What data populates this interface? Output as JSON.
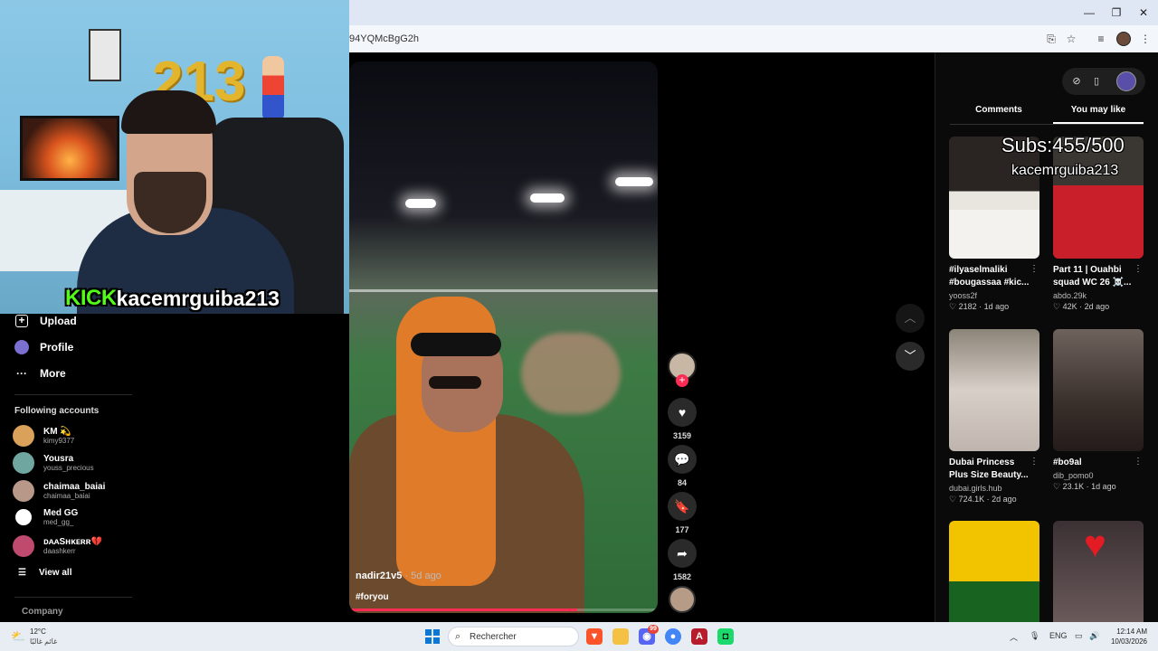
{
  "browser": {
    "url": "94YQMcBgG2h",
    "window_controls": [
      "minimize",
      "maximize",
      "close"
    ]
  },
  "stream": {
    "platform_label": "KICK",
    "channel_name": "kacemrguiba213",
    "balloons_text": "213"
  },
  "sidebar": {
    "nav": [
      {
        "label": "Upload",
        "icon": "upload-icon"
      },
      {
        "label": "Profile",
        "icon": "profile-icon"
      },
      {
        "label": "More",
        "icon": "more-icon"
      }
    ],
    "following_title": "Following accounts",
    "accounts": [
      {
        "name": "KM 💫",
        "handle": "kimy9377",
        "color": "#d9a15a"
      },
      {
        "name": "Yousra",
        "handle": "youss_precious",
        "color": "#6fa6a0"
      },
      {
        "name": "chaimaa_baiai",
        "handle": "chaimaa_baiai",
        "color": "#b89888"
      },
      {
        "name": "Med GG",
        "handle": "med_gg_",
        "color": "#ffffff"
      },
      {
        "name": "ᴅᴀᴀSʜᴋᴇʀʀ💔",
        "handle": "daashkerr",
        "color": "#c04a6e"
      }
    ],
    "view_all": "View all",
    "company": "Company"
  },
  "video": {
    "author": "nadir21v5",
    "age": "· 5d ago",
    "tag": "#foryou",
    "progress_fraction": 0.74
  },
  "actions": {
    "likes": "3159",
    "comments": "84",
    "saves": "177",
    "shares": "1582"
  },
  "right_panel": {
    "tabs": [
      "Comments",
      "You may like"
    ],
    "active_tab": "You may like",
    "overlay_subs": "Subs:455/500",
    "overlay_name": "kacemrguiba213",
    "cards": [
      {
        "title": "#ilyaselmaliki #bougassaa #kic...",
        "author": "yooss2f",
        "likes": "2182",
        "age": "1d ago"
      },
      {
        "title": "Part 11 | Ouahbi squad WC 26 ☠️...",
        "author": "abdo.29k",
        "likes": "42K",
        "age": "2d ago"
      },
      {
        "title": "Dubai Princess Plus Size Beauty...",
        "author": "dubai.girls.hub",
        "likes": "724.1K",
        "age": "2d ago"
      },
      {
        "title": "#bo9al",
        "author": "dib_pomo0",
        "likes": "23.1K",
        "age": "1d ago"
      }
    ]
  },
  "taskbar": {
    "weather_temp": "12°C",
    "weather_desc": "غائم غالبًا",
    "search_placeholder": "Rechercher",
    "discord_badge": "99",
    "lang": "ENG",
    "time": "12:14 AM",
    "date": "10/03/2026"
  },
  "colors": {
    "accent_red": "#fe2c55",
    "kick_green": "#53fc18"
  }
}
